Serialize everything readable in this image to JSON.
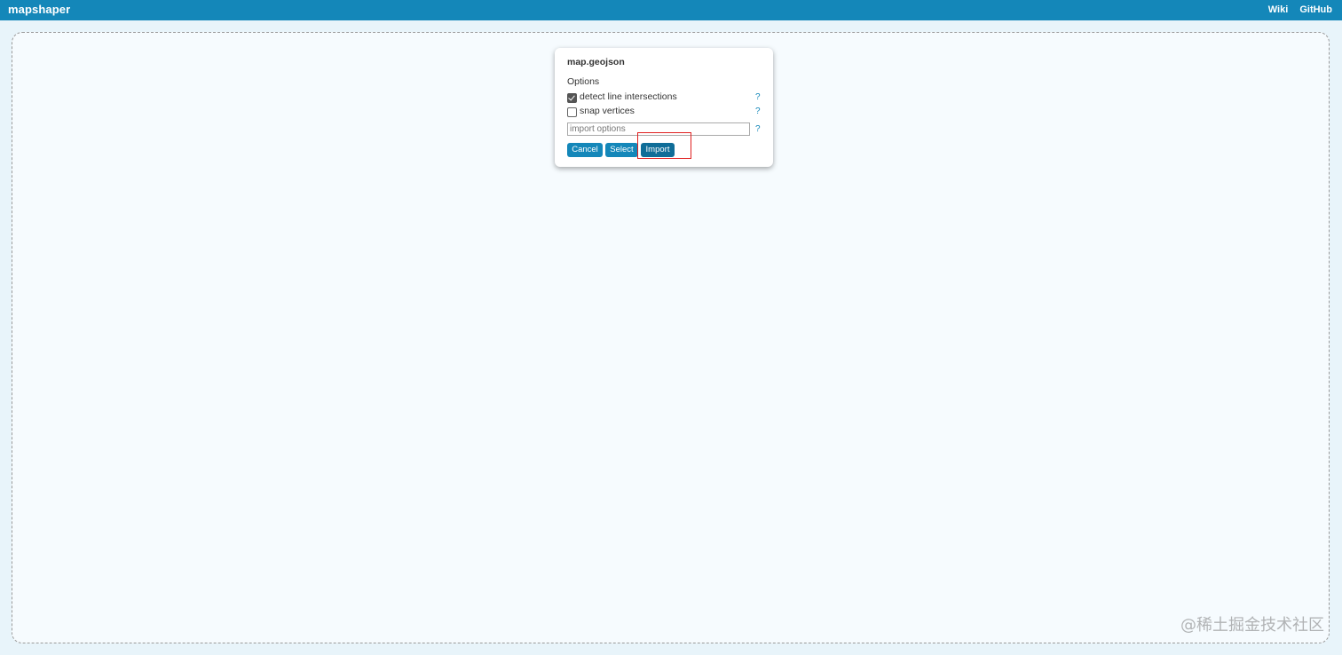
{
  "header": {
    "brand": "mapshaper",
    "nav": [
      "Wiki",
      "GitHub"
    ],
    "bg_color": "#1487b9"
  },
  "dialog": {
    "filename": "map.geojson",
    "options_heading": "Options",
    "options": [
      {
        "label": "detect line intersections",
        "checked": true,
        "help": "?"
      },
      {
        "label": "snap vertices",
        "checked": false,
        "help": "?"
      }
    ],
    "import_options_placeholder": "import options",
    "import_options_help": "?",
    "buttons": {
      "cancel": "Cancel",
      "select": "Select",
      "import": "Import"
    }
  },
  "annotation": {
    "highlight_target": "Import",
    "highlight_color": "#e02020"
  },
  "watermark": "@稀土掘金技术社区"
}
